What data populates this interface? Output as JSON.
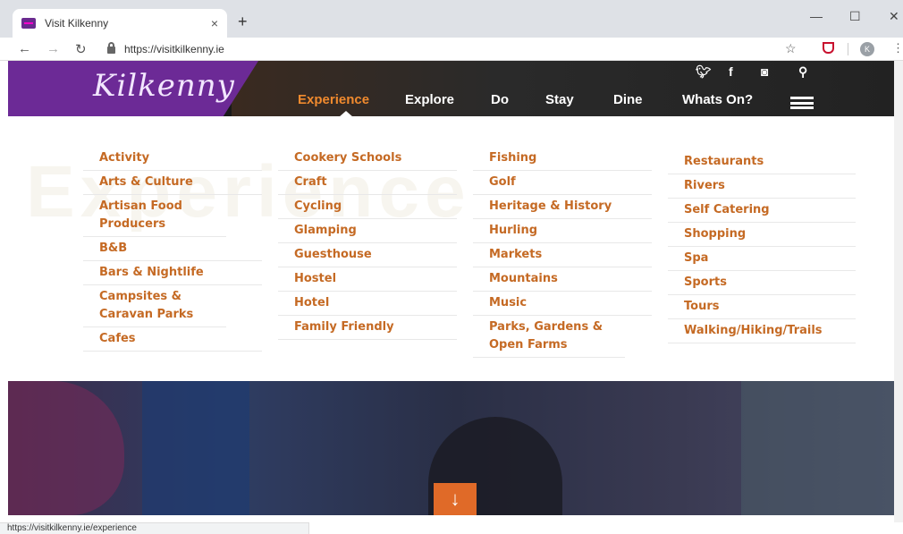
{
  "browser": {
    "tab_title": "Visit Kilkenny",
    "tab_close": "×",
    "new_tab": "+",
    "url": "https://visitkilkenny.ie",
    "profile_initial": "K",
    "status_url": "https://visitkilkenny.ie/experience"
  },
  "header": {
    "logo": "Kilkenny",
    "nav": [
      "Experience",
      "Explore",
      "Do",
      "Stay",
      "Dine",
      "Whats On?"
    ],
    "active_nav": "Experience",
    "accent_color": "#f08a2e",
    "brand_color": "#6c2a96",
    "social_icons": [
      "twitter-icon",
      "facebook-icon",
      "instagram-icon",
      "search-icon"
    ]
  },
  "menu": {
    "watermark": "Experience",
    "columns": [
      [
        "Activity",
        "Arts & Culture",
        "Artisan Food Producers",
        "B&B",
        "Bars & Nightlife",
        "Campsites & Caravan Parks",
        "Cafes"
      ],
      [
        "Cookery Schools",
        "Craft",
        "Cycling",
        "Glamping",
        "Guesthouse",
        "Hostel",
        "Hotel",
        "Family Friendly"
      ],
      [
        "Fishing",
        "Golf",
        "Heritage & History",
        "Hurling",
        "Markets",
        "Mountains",
        "Music",
        "Parks, Gardens & Open Farms"
      ],
      [
        "Restaurants",
        "Rivers",
        "Self Catering",
        "Shopping",
        "Spa",
        "Sports",
        "Tours",
        "Walking/Hiking/Trails"
      ]
    ]
  },
  "hero": {
    "scroll_arrow": "↓"
  }
}
